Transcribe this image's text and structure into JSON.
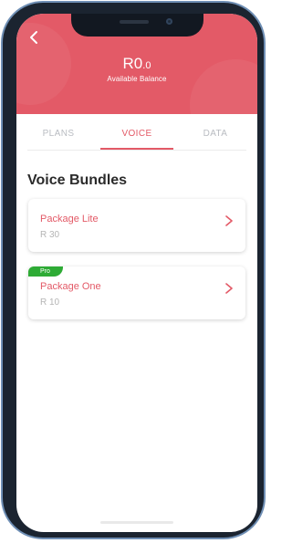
{
  "header": {
    "balance_main": "R0",
    "balance_cents": ".0",
    "balance_label": "Available Balance",
    "back_icon": "chevron-left-icon"
  },
  "tabs": [
    {
      "label": "PLANS",
      "active": false
    },
    {
      "label": "VOICE",
      "active": true
    },
    {
      "label": "DATA",
      "active": false
    }
  ],
  "section": {
    "title": "Voice Bundles"
  },
  "bundles": [
    {
      "name": "Package Lite",
      "price": "R 30",
      "badge": ""
    },
    {
      "name": "Package One",
      "price": "R 10",
      "badge": "Pro"
    }
  ],
  "colors": {
    "accent": "#e35a67",
    "badge": "#2eab35"
  }
}
